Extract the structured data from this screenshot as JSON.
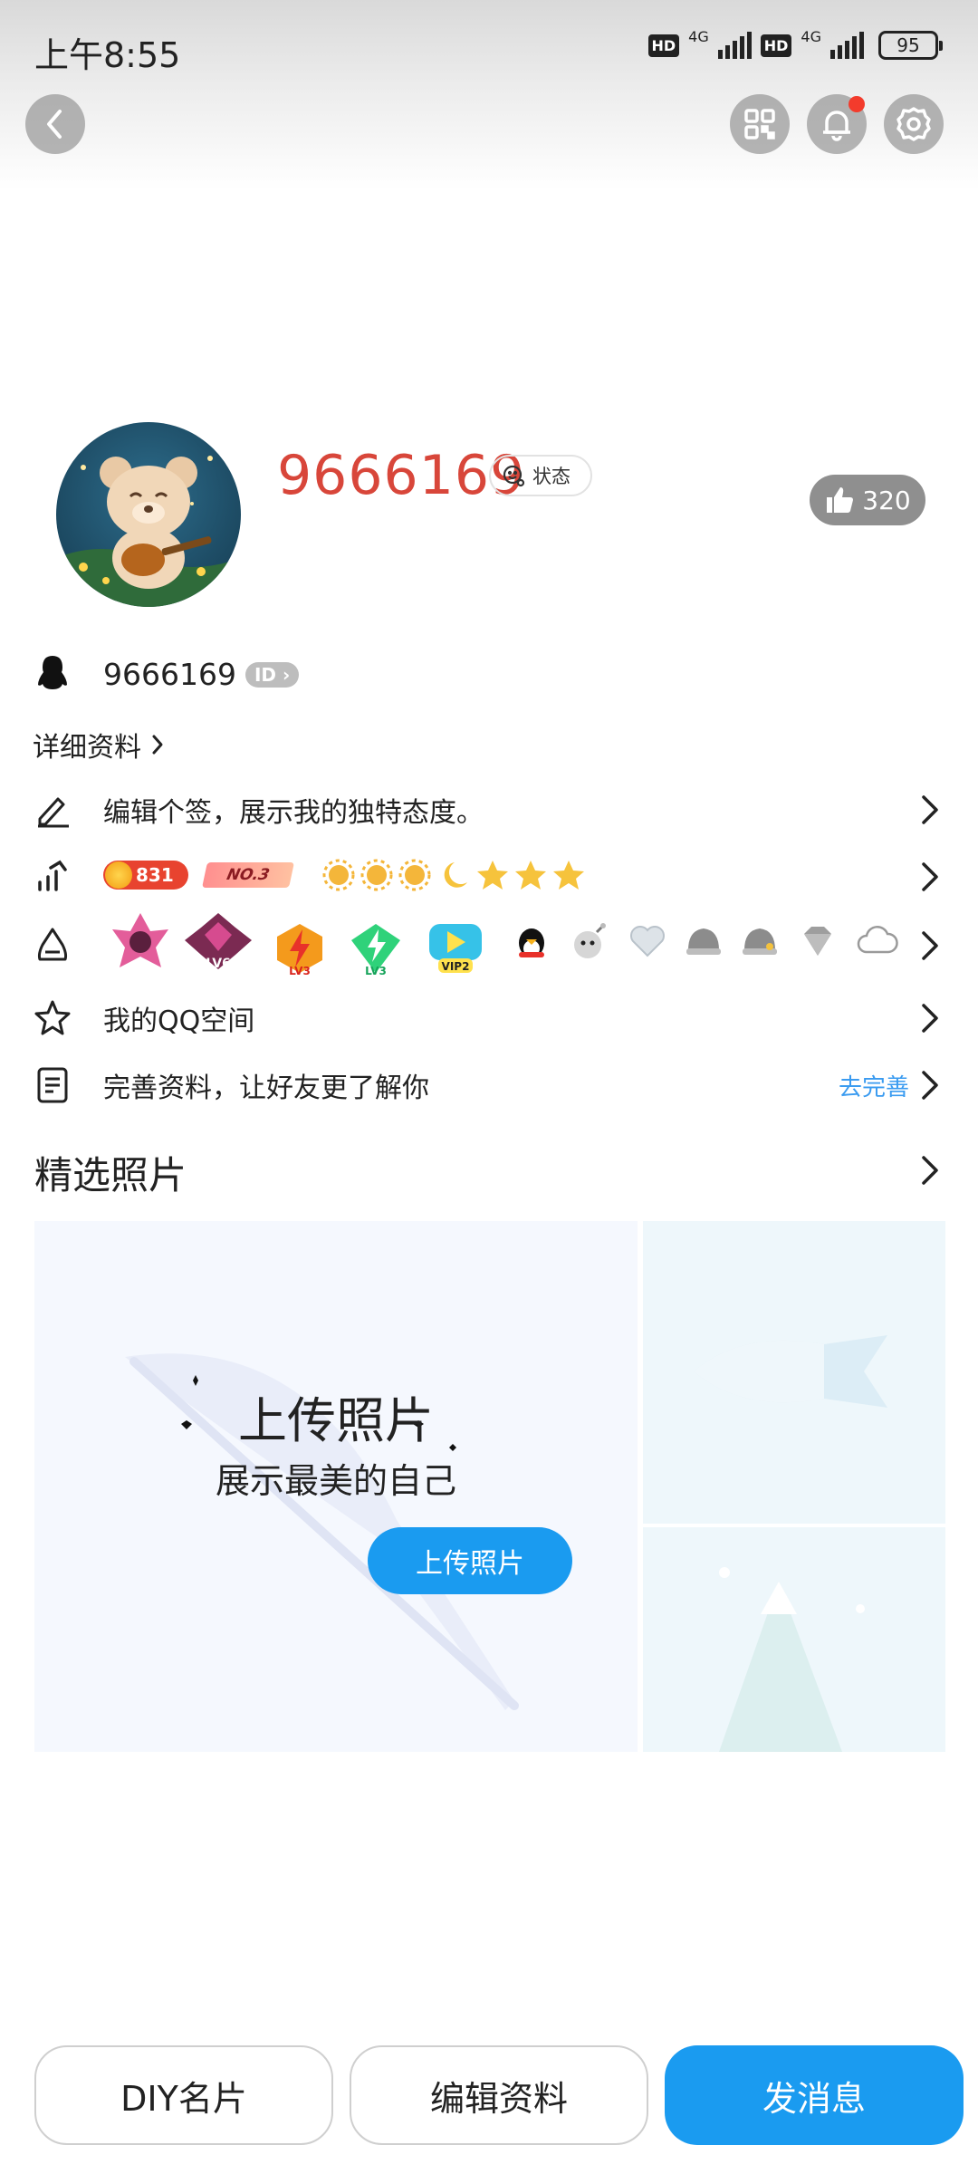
{
  "status_bar": {
    "time": "上午8:55",
    "hd1": "HD",
    "net1": "4G",
    "hd2": "HD",
    "net2": "4G",
    "battery": "95"
  },
  "header": {
    "back_icon": "chevron-left-icon",
    "qr_icon": "qr-code-icon",
    "bell_icon": "bell-icon",
    "settings_icon": "gear-icon"
  },
  "profile": {
    "nickname": "9666169",
    "status_label": "状态",
    "likes": "320",
    "qq_number": "9666169",
    "id_badge": "ID",
    "detail_link": "详细资料"
  },
  "rows": {
    "signature": "编辑个签，展示我的独特态度。",
    "level_badge_value": "831",
    "rank_badge": "NO.3",
    "space": "我的QQ空间",
    "complete": "完善资料，让好友更了解你",
    "complete_action": "去完善"
  },
  "emblems": {
    "lv_labels": [
      "LV6",
      "LV3",
      "LV3",
      "VIP2"
    ]
  },
  "photos": {
    "section_title": "精选照片",
    "upload_title": "上传照片",
    "upload_sub": "展示最美的自己",
    "upload_button": "上传照片"
  },
  "bottom_bar": {
    "diy": "DIY名片",
    "edit": "编辑资料",
    "message": "发消息"
  },
  "colors": {
    "accent": "#1a9bf0",
    "nickname": "#d8463a",
    "notification_dot": "#f33b2c"
  }
}
